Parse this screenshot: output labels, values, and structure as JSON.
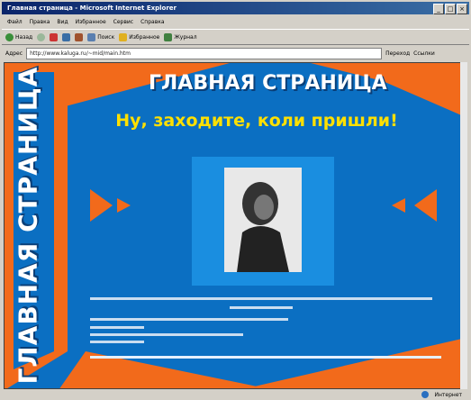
{
  "window": {
    "title": "Главная страница - Microsoft Internet Explorer"
  },
  "menu": [
    "Файл",
    "Правка",
    "Вид",
    "Избранное",
    "Сервис",
    "Справка"
  ],
  "toolbar": {
    "buttons": [
      "Назад",
      "Вперёд",
      "Стоп",
      "Обновить",
      "Домой",
      "Поиск",
      "Избранное",
      "Журнал"
    ]
  },
  "address": {
    "label": "Адрес",
    "value": "http://www.kaluga.ru/~mid/main.htm",
    "go": "Переход",
    "links": "Ссылки"
  },
  "page": {
    "vertical_title": "ГЛАВНАЯ СТРАНИЦА",
    "banner": "ГЛАВНАЯ СТРАНИЦА",
    "greeting": "Ну, заходите, коли пришли!"
  },
  "status": {
    "zone": "Интернет"
  },
  "colors": {
    "bg": "#0b6fc2",
    "orange": "#f26a1b",
    "yellow": "#ffe000"
  }
}
